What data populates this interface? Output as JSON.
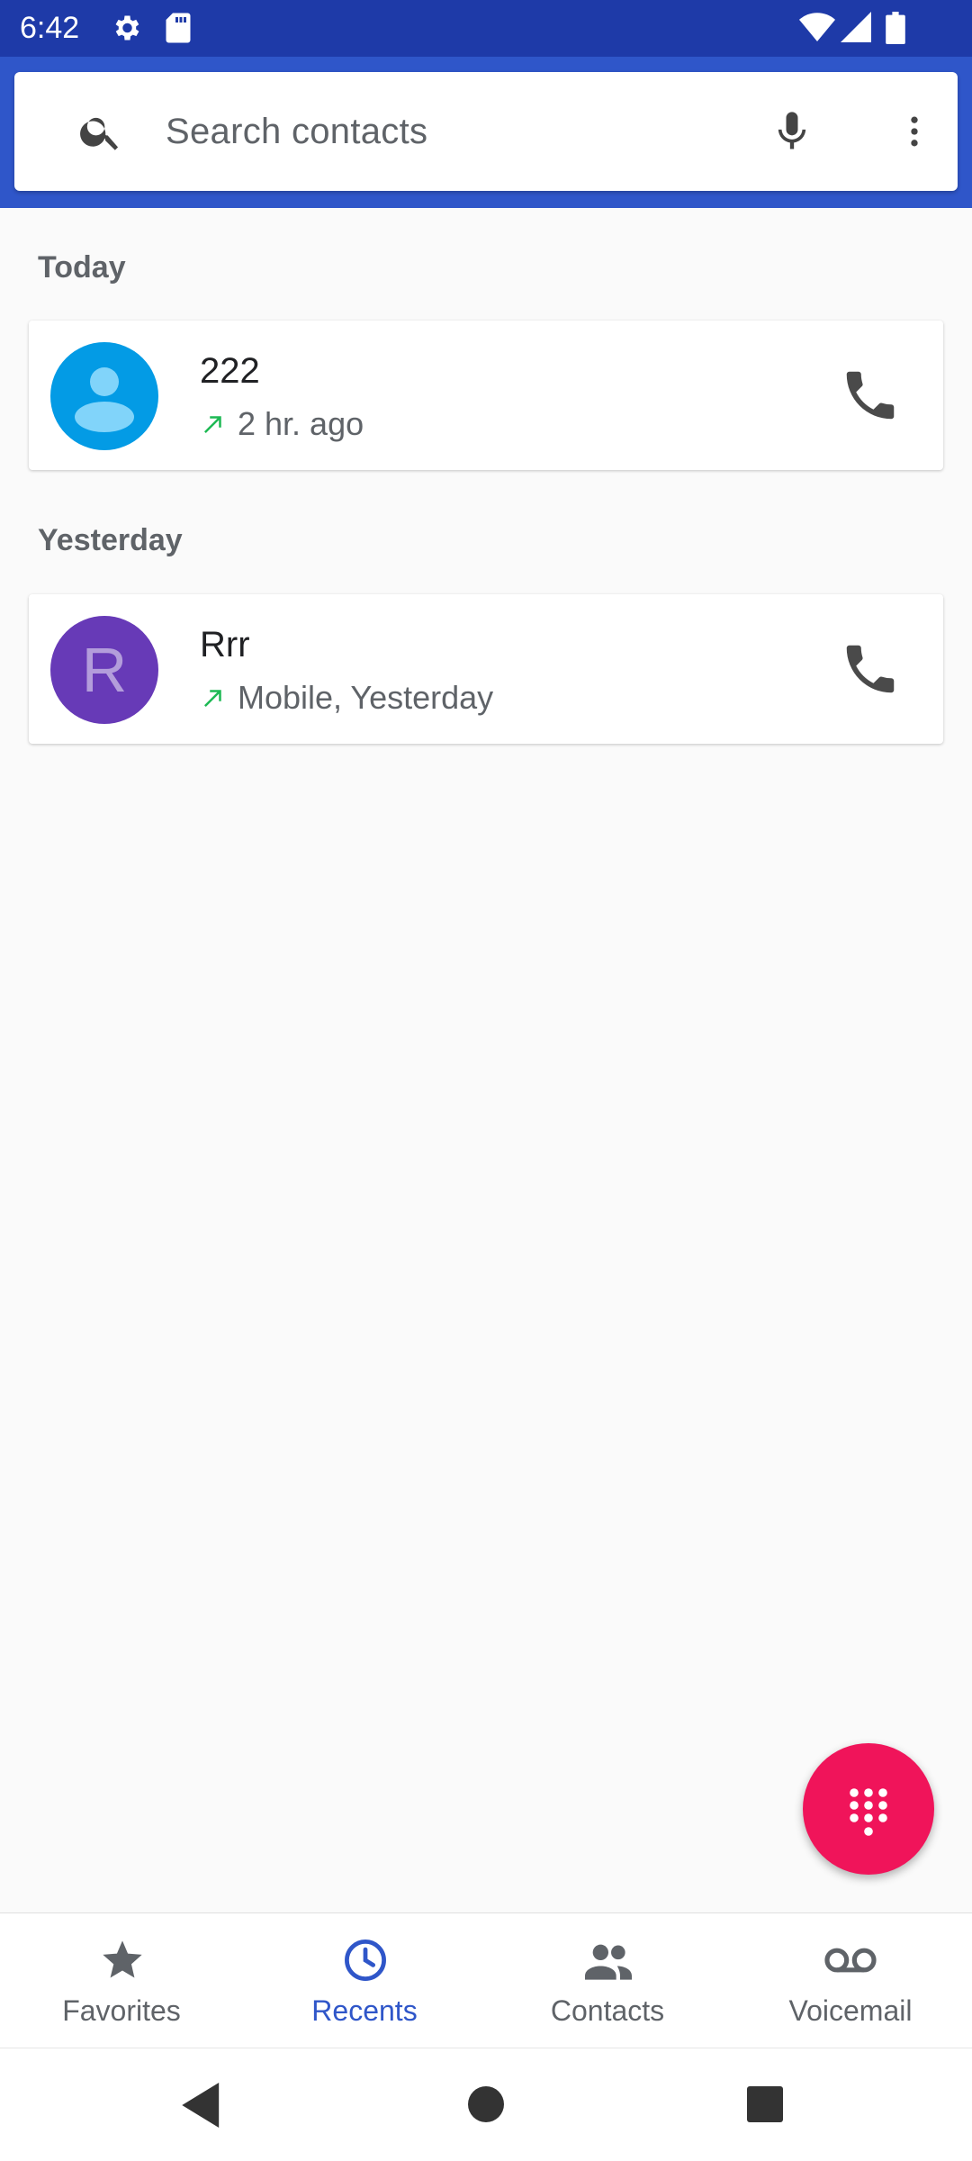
{
  "status_bar": {
    "time": "6:42",
    "left_icons": [
      "gear-icon",
      "sd-card-icon"
    ],
    "right_icons": [
      "wifi-icon",
      "cell-signal-icon",
      "battery-icon"
    ]
  },
  "search": {
    "placeholder": "Search contacts",
    "icons": [
      "search-icon",
      "mic-icon",
      "more-vert-icon"
    ]
  },
  "sections": [
    {
      "title": "Today",
      "calls": [
        {
          "name": "222",
          "detail": "2 hr. ago",
          "call_direction": "outgoing",
          "avatar": {
            "type": "placeholder-person",
            "color": "#039be5"
          }
        }
      ]
    },
    {
      "title": "Yesterday",
      "calls": [
        {
          "name": "Rrr",
          "detail": "Mobile, Yesterday",
          "call_direction": "outgoing",
          "avatar": {
            "type": "letter",
            "letter": "R",
            "color": "#673ab7"
          }
        }
      ]
    }
  ],
  "fab": {
    "icon": "dialpad-icon",
    "color": "#f0145a"
  },
  "bottom_nav": {
    "items": [
      {
        "label": "Favorites",
        "icon": "star-icon",
        "active": false
      },
      {
        "label": "Recents",
        "icon": "clock-icon",
        "active": true
      },
      {
        "label": "Contacts",
        "icon": "people-icon",
        "active": false
      },
      {
        "label": "Voicemail",
        "icon": "voicemail-icon",
        "active": false
      }
    ]
  },
  "system_nav": [
    "back-icon",
    "home-icon",
    "recents-square-icon"
  ],
  "colors": {
    "status_bar": "#1e3aa8",
    "header": "#2f56c9",
    "accent": "#2f56c9",
    "outgoing_arrow": "#1db954"
  }
}
